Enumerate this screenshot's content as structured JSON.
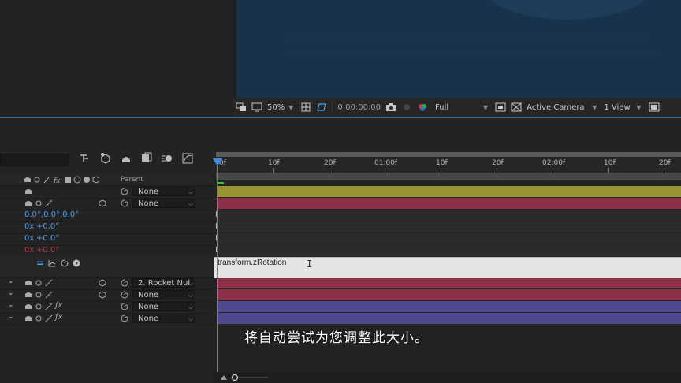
{
  "viewer": {
    "zoom": "50%",
    "timecode": "0:00:00:00",
    "resolution": "Full",
    "camera": "Active Camera",
    "views": "1 View"
  },
  "timeline": {
    "parent_header": "Parent",
    "ruler_labels": [
      "0f",
      "10f",
      "20f",
      "01:00f",
      "10f",
      "20f",
      "02:00f",
      "10f",
      "20f"
    ],
    "layers": [
      {
        "parent": "None",
        "bar": "olive"
      },
      {
        "parent": "None",
        "bar": "red"
      },
      {
        "parent": "2. Rocket Nul",
        "bar": "red"
      },
      {
        "parent": "None",
        "bar": "red"
      },
      {
        "parent": "None",
        "bar": "purple"
      },
      {
        "parent": "None",
        "bar": "purple"
      }
    ],
    "properties": {
      "orientation": "0.0°,0.0°,0.0°",
      "x_rotation_mult": "0x",
      "x_rotation_val": "+0.0°",
      "y_rotation_mult": "0x",
      "y_rotation_val": "+0.0°",
      "z_rotation_mult": "0x",
      "z_rotation_val": "+0.0°",
      "expression_equals": "="
    },
    "expression": "transform.zRotation"
  },
  "subtitle": "将自动尝试为您调整此大小。",
  "colors": {
    "accent_blue": "#3a8de0",
    "bar_olive": "#989435",
    "bar_red": "#8c3148",
    "bar_purple": "#4f4a8d",
    "viewer_bg": "#17324a"
  }
}
